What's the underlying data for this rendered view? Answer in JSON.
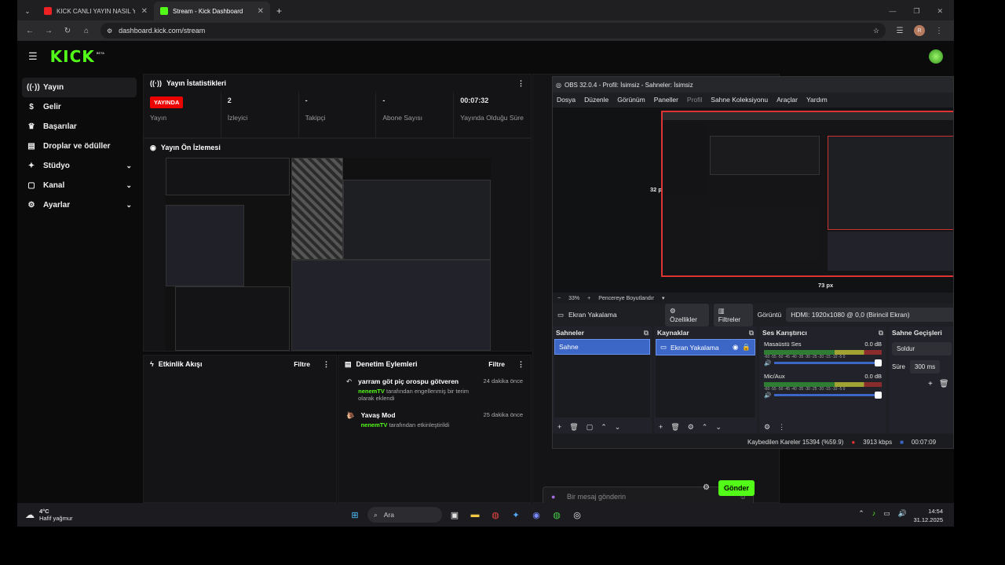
{
  "browser": {
    "tabs": [
      {
        "label": "KICK CANLI YAYIN NASIL YAPIL",
        "active": false
      },
      {
        "label": "Stream - Kick Dashboard",
        "active": true
      }
    ],
    "url": "dashboard.kick.com/stream",
    "profile_initial": "R"
  },
  "kick": {
    "logo": "KICK",
    "logo_badge": "BETA",
    "sidebar": [
      {
        "label": "Yayın",
        "icon": "broadcast-icon",
        "active": true
      },
      {
        "label": "Gelir",
        "icon": "dollar-icon"
      },
      {
        "label": "Başarılar",
        "icon": "trophy-icon"
      },
      {
        "label": "Droplar ve ödüller",
        "icon": "gift-icon"
      },
      {
        "label": "Stüdyo",
        "icon": "studio-icon",
        "expandable": true
      },
      {
        "label": "Kanal",
        "icon": "channel-icon",
        "expandable": true
      },
      {
        "label": "Ayarlar",
        "icon": "settings-icon",
        "expandable": true
      }
    ],
    "stats": {
      "title": "Yayın İstatistikleri",
      "live_badge": "YAYINDA",
      "items": [
        {
          "value": "",
          "label": "Yayın"
        },
        {
          "value": "2",
          "label": "İzleyici"
        },
        {
          "value": "-",
          "label": "Takipçi"
        },
        {
          "value": "-",
          "label": "Abone Sayısı"
        },
        {
          "value": "00:07:32",
          "label": "Yayında Olduğu Süre"
        }
      ]
    },
    "preview": {
      "title": "Yayın Ön İzlemesi"
    },
    "activity": {
      "title": "Etkinlik Akışı",
      "filter": "Filtre"
    },
    "moderation": {
      "title": "Denetim Eylemleri",
      "filter": "Filtre",
      "items": [
        {
          "title": "yarram göt piç orospu götveren",
          "user": "nenemTV",
          "desc": "tarafından engellenmiş bir terim olarak eklendi",
          "ago": "24 dakika önce"
        },
        {
          "title": "Yavaş Mod",
          "user": "nenemTV",
          "desc": "tarafından etkinleştirildi",
          "ago": "25 dakika önce"
        }
      ]
    },
    "chat": {
      "placeholder": "Bir mesaj gönderin",
      "send": "Gönder"
    }
  },
  "obs": {
    "title": "OBS 32.0.4 - Profil: İsimsiz - Sahneler: İsimsiz",
    "menu": [
      "Dosya",
      "Düzenle",
      "Görünüm",
      "Paneller",
      "Profil",
      "Sahne Koleksiyonu",
      "Araçlar",
      "Yardım"
    ],
    "measure_left": "32 px",
    "measure_bottom": "73 px",
    "zoom": "33%",
    "fit": "Pencereye Boyutlandır",
    "source_name": "Ekran Yakalama",
    "properties": "Özellikler",
    "filters": "Filtreler",
    "display_label": "Görüntü",
    "display_value": "HDMI: 1920x1080 @ 0,0 (Birincil Ekran)",
    "scenes": {
      "title": "Sahneler",
      "items": [
        "Sahne"
      ]
    },
    "sources": {
      "title": "Kaynaklar",
      "items": [
        "Ekran Yakalama"
      ]
    },
    "mixer": {
      "title": "Ses Karıştırıcı",
      "channels": [
        {
          "name": "Masaüstü Ses",
          "db": "0.0 dB",
          "level": 0.85
        },
        {
          "name": "Mic/Aux",
          "db": "0.0 dB",
          "level": 0.85
        }
      ],
      "scale": "-60 -55 -50 -45 -40 -35 -30 -25 -20 -15 -10 -5 0"
    },
    "transitions": {
      "title": "Sahne Geçişleri",
      "type": "Soldur",
      "duration_label": "Süre",
      "duration": "300 ms"
    },
    "status": {
      "dropped": "Kaybedilen Kareler 15394 (%59.9)",
      "bitrate": "3913 kbps",
      "time": "00:07:09"
    }
  },
  "taskbar": {
    "temp": "4°C",
    "weather": "Hafif yağmur",
    "search": "Ara",
    "time": "14:54",
    "date": "31.12.2025"
  }
}
